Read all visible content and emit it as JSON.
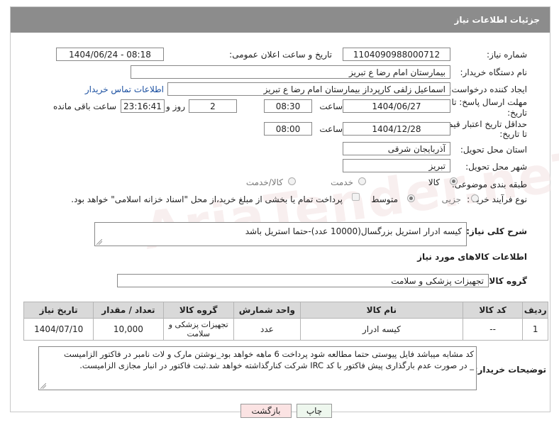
{
  "panel": {
    "title": "جزئیات اطلاعات نیاز"
  },
  "fields": {
    "need_number_label": "شماره نیاز:",
    "need_number": "1104090988000712",
    "announce_label": "تاریخ و ساعت اعلان عمومی:",
    "announce_value": "1404/06/24 - 08:18",
    "buyer_org_label": "نام دستگاه خریدار:",
    "buyer_org": "بیمارستان امام رضا  ع  تبریز",
    "creator_label": "ایجاد کننده درخواست:",
    "creator": "اسماعیل زلفی کارپرداز بیمارستان امام رضا  ع  تبریز",
    "contact_link": "اطلاعات تماس خریدار",
    "deadline_label_1": "مهلت ارسال پاسخ: تا",
    "deadline_label_2": "تاریخ:",
    "deadline_date": "1404/06/27",
    "time_label": "ساعت",
    "deadline_time": "08:30",
    "days": "2",
    "days_label": "روز و",
    "remaining": "23:16:41",
    "remaining_label": "ساعت باقی مانده",
    "price_label_1": "حداقل تاریخ اعتبار قیمت:",
    "price_label_2": "تا تاریخ:",
    "price_date": "1404/12/28",
    "price_time": "08:00",
    "province_label": "استان محل تحویل:",
    "province": "آذربایجان شرقی",
    "city_label": "شهر محل تحویل:",
    "city": "تبریز",
    "category_label": "طبقه بندی موضوعی:",
    "category_options": [
      "کالا",
      "خدمت",
      "کالا/خدمت"
    ],
    "process_label": "نوع فرآیند خرید :",
    "process_options": [
      "جزیی",
      "متوسط"
    ],
    "payment_note": "پرداخت تمام یا بخشی از مبلغ خرید،از محل \"اسناد خزانه اسلامی\" خواهد بود."
  },
  "description": {
    "label": "شرح کلی نیاز:",
    "text": "کیسه ادرار استریل بزرگسال(10000 عدد)-حتما استریل باشد"
  },
  "goods": {
    "section_title": "اطلاعات کالاهای مورد نیاز",
    "group_label": "گروه کالا:",
    "group_value": "تجهیزات پزشکی و سلامت"
  },
  "table": {
    "headers": [
      "ردیف",
      "کد کالا",
      "نام کالا",
      "واحد شمارش",
      "گروه کالا",
      "تعداد / مقدار",
      "تاریخ نیاز"
    ],
    "rows": [
      {
        "row": "1",
        "code": "--",
        "name": "کیسه ادرار",
        "unit": "عدد",
        "group": "تجهیزات پزشکی و سلامت",
        "qty": "10,000",
        "date": "1404/07/10"
      }
    ]
  },
  "buyer_notes": {
    "label": "توضیحات خریدار:",
    "line1": "کد مشابه میباشد فایل پیوستی حتما مطالعه شود  پرداخت 6 ماهه خواهد بود_نوشتن مارک و لات نامبر در فاکتور الزامیست",
    "line2": "_ در صورت عدم بارگذاری پیش فاکتور با کد IRC  شرکت کنارگذاشته خواهد شد.ثبت فاکتور در انبار مجازی الزامیست."
  },
  "buttons": {
    "print": "چاپ",
    "back": "بازگشت"
  },
  "watermark": "AriaTender.neT",
  "colors": {
    "header_bg": "#8c8c8c",
    "link": "#1a4fa0",
    "table_header": "#d9d9d9",
    "back_button_bg": "#fbe3e3",
    "print_button_bg": "#eef7ee"
  }
}
